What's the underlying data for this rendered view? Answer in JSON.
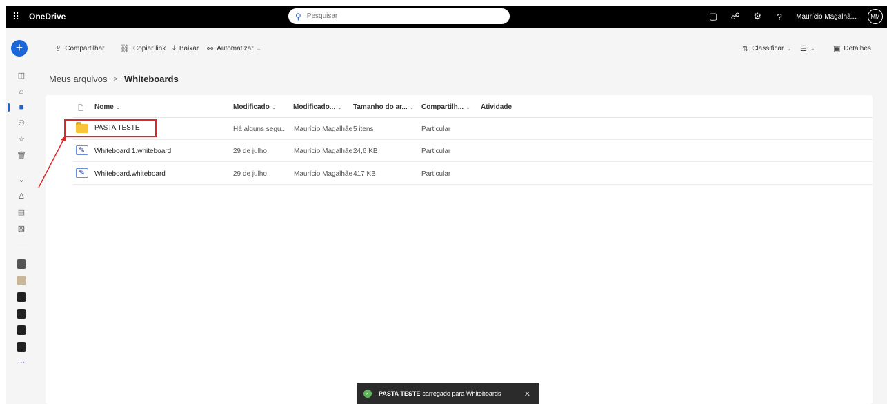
{
  "topbar": {
    "app_title": "OneDrive",
    "search_placeholder": "Pesquisar",
    "user_name": "Maurício Magalhã...",
    "avatar_initials": "MM"
  },
  "commands": {
    "share": "Compartilhar",
    "copy_link": "Copiar link",
    "download": "Baixar",
    "automate": "Automatizar",
    "sort": "Classificar",
    "details": "Detalhes"
  },
  "breadcrumb": {
    "root": "Meus arquivos",
    "separator": ">",
    "current": "Whiteboards"
  },
  "columns": {
    "name": "Nome",
    "modified": "Modificado",
    "modified_by": "Modificado...",
    "size": "Tamanho do ar...",
    "sharing": "Compartilh...",
    "activity": "Atividade"
  },
  "files": [
    {
      "name": "PASTA TESTE",
      "modified": "Há alguns segu...",
      "modified_by": "Maurício Magalhãe",
      "size": "5 itens",
      "sharing": "Particular",
      "type": "folder"
    },
    {
      "name": "Whiteboard 1.whiteboard",
      "modified": "29 de julho",
      "modified_by": "Maurício Magalhãe",
      "size": "24,6 KB",
      "sharing": "Particular",
      "type": "whiteboard"
    },
    {
      "name": "Whiteboard.whiteboard",
      "modified": "29 de julho",
      "modified_by": "Maurício Magalhãe",
      "size": "417 KB",
      "sharing": "Particular",
      "type": "whiteboard"
    }
  ],
  "toast": {
    "item": "PASTA TESTE",
    "message": "carregado para Whiteboards"
  },
  "colors": {
    "accent": "#1a66d8",
    "highlight": "#e0262b",
    "folder": "#f7c43a"
  }
}
